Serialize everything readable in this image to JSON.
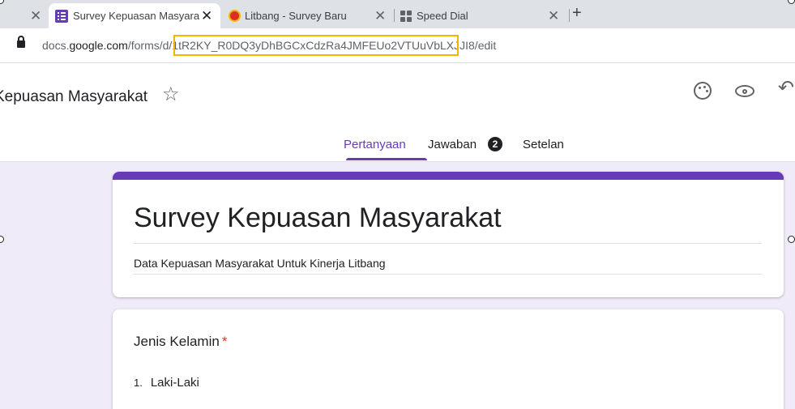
{
  "browser": {
    "tabs": [
      {
        "title": "",
        "close": "✕"
      },
      {
        "title": "Survey Kepuasan Masyarak",
        "close": "✕"
      },
      {
        "title": "Litbang - Survey Baru",
        "close": "✕"
      },
      {
        "title": "Speed Dial",
        "close": "✕"
      }
    ],
    "new_tab": "+",
    "url": {
      "prefix": "docs.",
      "host": "google.com",
      "path_before": "/forms/d/",
      "form_id": "1tR2KY_R0DQ3yDhBGCxCdzRa4JMFEUo2VTUuVbLXJJI8/",
      "path_after": "edit",
      "highlight_color": "#f4b400"
    }
  },
  "forms_header": {
    "doc_title": "Kepuasan Masyarakat",
    "star": "☆",
    "undo": "↶",
    "tabs": [
      {
        "label": "Pertanyaan"
      },
      {
        "label": "Jawaban",
        "badge": "2"
      },
      {
        "label": "Setelan"
      }
    ],
    "accent_color": "#673ab7"
  },
  "form": {
    "title": "Survey Kepuasan Masyarakat",
    "description": "Data Kepuasan Masyarakat Untuk Kinerja Litbang",
    "questions": [
      {
        "title": "Jenis Kelamin",
        "required_mark": "*",
        "options": [
          {
            "num": "1.",
            "label": "Laki-Laki"
          }
        ]
      }
    ]
  },
  "colors": {
    "canvas_bg": "#f0ebf8",
    "required": "#d93025"
  }
}
